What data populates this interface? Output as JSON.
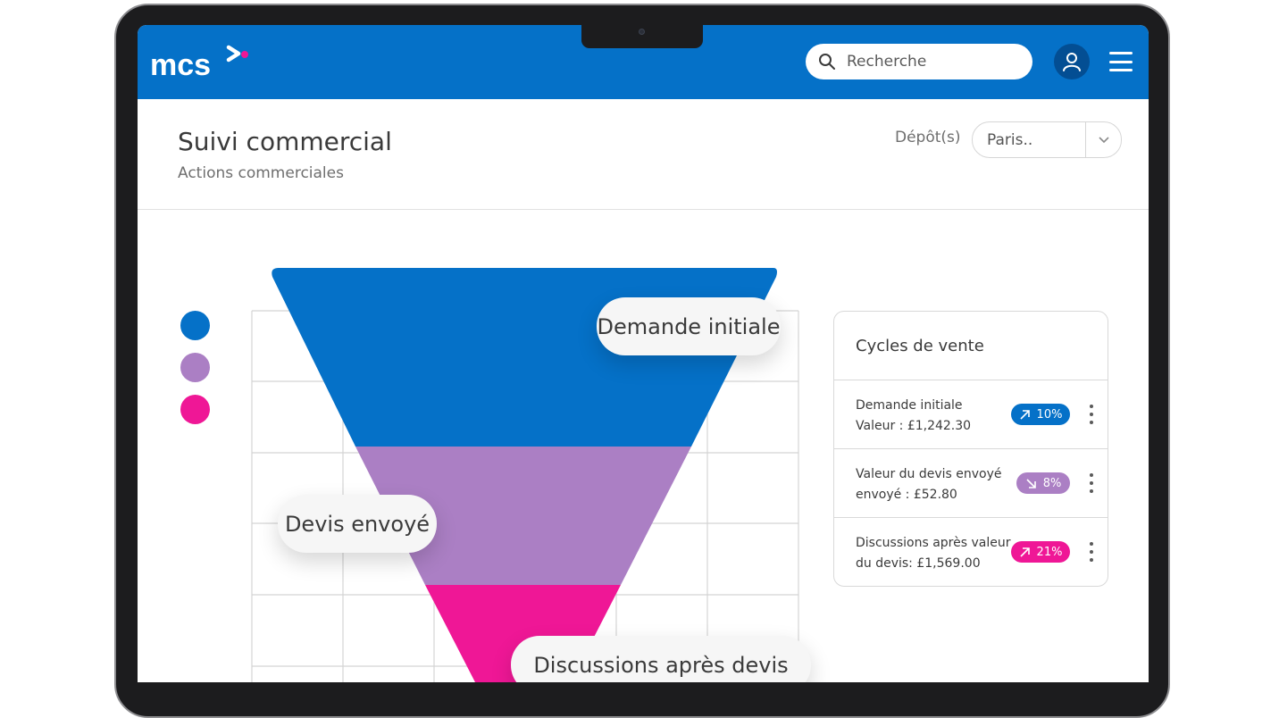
{
  "app": {
    "logo_text": "mcs"
  },
  "header": {
    "search_placeholder": "Recherche"
  },
  "page": {
    "title": "Suivi commercial",
    "subtitle": "Actions commerciales",
    "depot_label": "Dépôt(s)",
    "depot_value": "Paris.."
  },
  "colors": {
    "brand": "#0571c8",
    "stage1": "#0571c8",
    "stage2": "#ab7fc4",
    "stage3": "#ef1796"
  },
  "funnel": {
    "stages": [
      {
        "label": "Demande initiale",
        "color": "#0571c8"
      },
      {
        "label": "Devis envoyé",
        "color": "#ab7fc4"
      },
      {
        "label": "Discussions après devis",
        "color": "#ef1796"
      }
    ]
  },
  "cycles": {
    "title": "Cycles de vente",
    "items": [
      {
        "line1": "Demande initiale",
        "line2": "Valeur : £1,242.30",
        "percent": "10%",
        "trend": "up",
        "color": "#0571c8"
      },
      {
        "line1": "Valeur du devis envoyé",
        "line2": "envoyé : £52.80",
        "percent": "8%",
        "trend": "down",
        "color": "#ab7fc4"
      },
      {
        "line1": "Discussions après valeur",
        "line2": "du devis: £1,569.00",
        "percent": "21%",
        "trend": "up",
        "color": "#ef1796"
      }
    ]
  },
  "icons": {
    "search": "search-icon",
    "user": "user-icon",
    "menu": "hamburger-menu-icon",
    "caret": "chevron-down-icon",
    "trend_up": "arrow-up-right-icon",
    "trend_down": "arrow-down-right-icon",
    "more": "more-vertical-icon"
  }
}
